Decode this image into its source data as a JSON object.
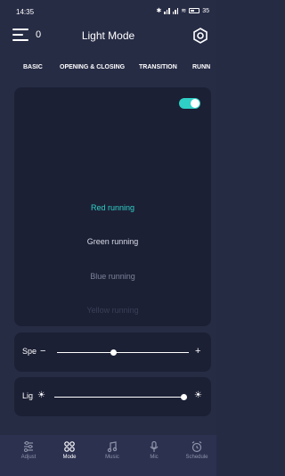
{
  "status_bar": {
    "time": "14:35",
    "battery": "35"
  },
  "header": {
    "count": "0",
    "title": "Light Mode"
  },
  "tabs": [
    {
      "label": "BASIC"
    },
    {
      "label": "OPENING & CLOSING"
    },
    {
      "label": "TRANSITION"
    },
    {
      "label": "RUNN"
    }
  ],
  "mode_card": {
    "toggle_on": true
  },
  "picker": {
    "items": [
      {
        "label": "Red running",
        "selected": true
      },
      {
        "label": "Green running"
      },
      {
        "label": "Blue running"
      },
      {
        "label": "Yellow running"
      }
    ]
  },
  "speed": {
    "label": "Spe",
    "minus": "−",
    "plus": "+",
    "level": 0.43
  },
  "light": {
    "label": "Lig",
    "level": 1.0
  },
  "nav": {
    "items": [
      {
        "label": "Adjust"
      },
      {
        "label": "Mode",
        "active": true
      },
      {
        "label": "Music"
      },
      {
        "label": "Mic"
      },
      {
        "label": "Schedule"
      }
    ]
  },
  "colors": {
    "accent": "#2fd0c6",
    "background": "#272c45",
    "card": "#1c2035"
  }
}
